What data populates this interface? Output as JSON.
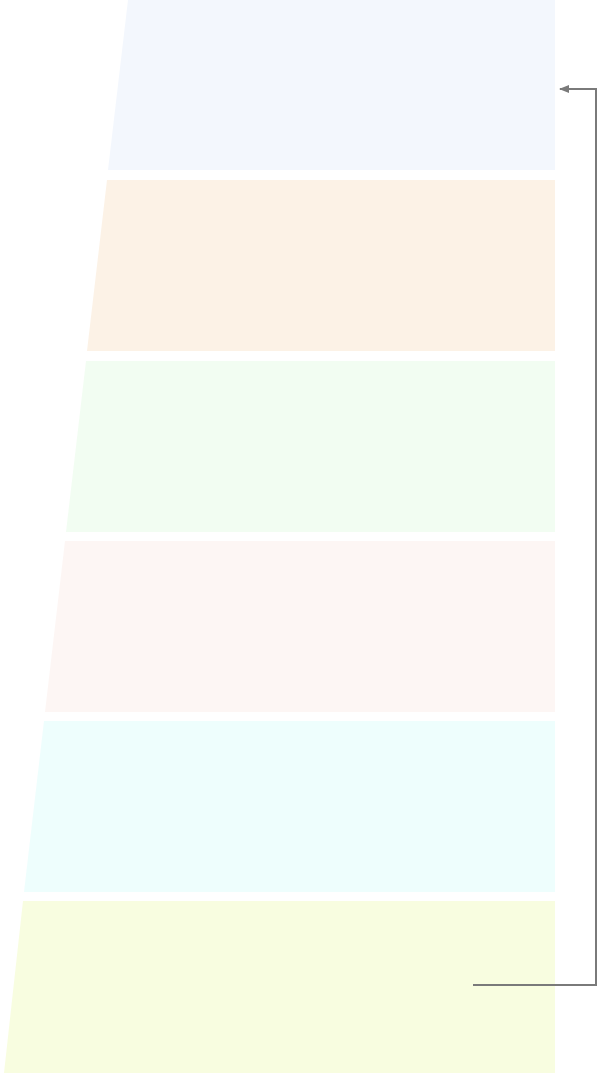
{
  "diagram": {
    "background": "#ffffff",
    "band_colors": [
      "#f3f7fd",
      "#fcf2e6",
      "#f2fdf2",
      "#fdf6f4",
      "#eefefd",
      "#f8fde0"
    ],
    "connector_color": "#7a7a7a"
  }
}
